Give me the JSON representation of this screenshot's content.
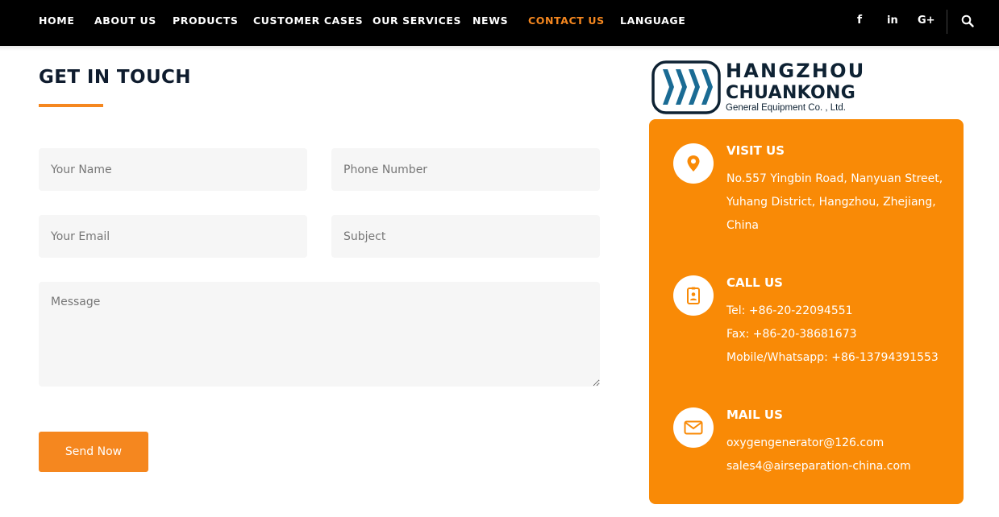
{
  "nav": {
    "items": [
      {
        "label": "HOME"
      },
      {
        "label": "ABOUT US"
      },
      {
        "label": "PRODUCTS"
      },
      {
        "label": "CUSTOMER CASES"
      },
      {
        "label": "OUR SERVICES"
      },
      {
        "label": "NEWS"
      },
      {
        "label": "CONTACT US",
        "active": true
      },
      {
        "label": "LANGUAGE"
      }
    ],
    "social": {
      "facebook": "f",
      "linkedin": "in",
      "googleplus": "G+"
    },
    "accent_color": "#f5871f"
  },
  "form": {
    "title": "GET IN TOUCH",
    "name_placeholder": "Your Name",
    "phone_placeholder": "Phone Number",
    "email_placeholder": "Your Email",
    "subject_placeholder": "Subject",
    "message_placeholder": "Message",
    "submit_label": "Send Now"
  },
  "logo": {
    "line1": "HANGZHOU",
    "line2": "CHUANKONG",
    "line3": "General Equipment Co. , Ltd."
  },
  "contact": {
    "card_color": "#f98a06",
    "visit": {
      "title": "VISIT US",
      "lines": [
        "No.557 Yingbin Road, Nanyuan Street,",
        "Yuhang District, Hangzhou, Zhejiang,",
        "China"
      ],
      "icon": "map-pin-icon"
    },
    "call": {
      "title": "CALL US",
      "lines": [
        "Tel: +86-20-22094551",
        "Fax: +86-20-38681673",
        "Mobile/Whatsapp: +86-13794391553"
      ],
      "icon": "id-badge-icon"
    },
    "mail": {
      "title": "MAIL US",
      "lines": [
        "oxygengenerator@126.com",
        "sales4@airseparation-china.com"
      ],
      "icon": "envelope-icon"
    }
  }
}
